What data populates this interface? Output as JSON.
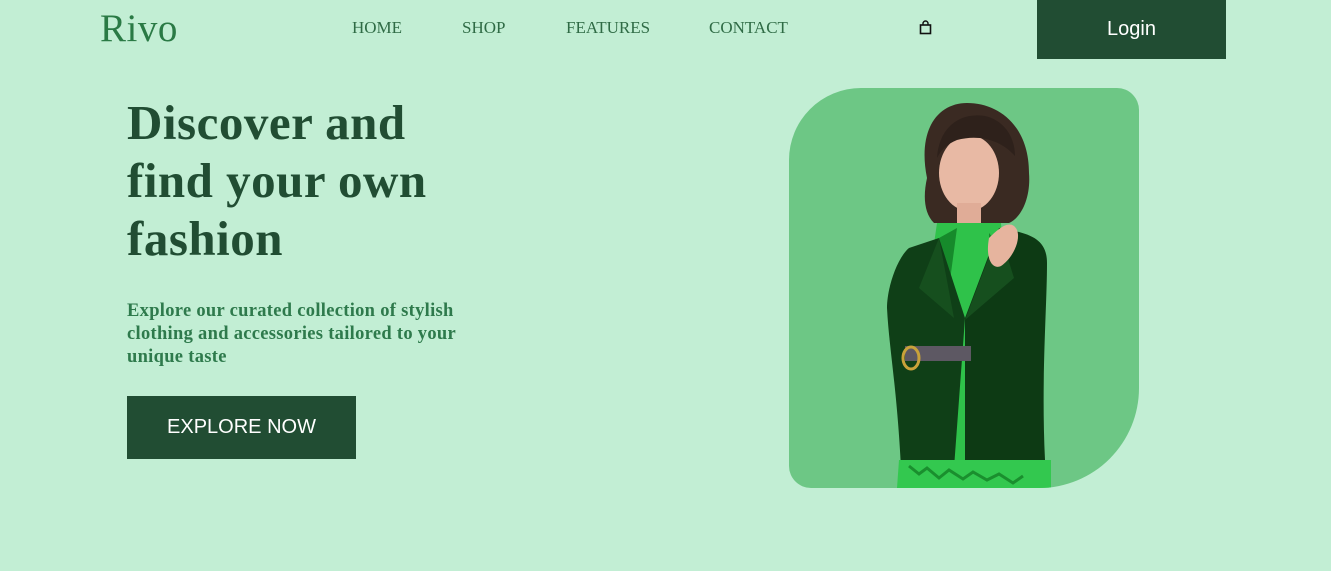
{
  "brand": {
    "logo": "Rivo"
  },
  "nav": {
    "items": [
      "HOME",
      "SHOP",
      "FEATURES",
      "CONTACT"
    ]
  },
  "header": {
    "cart_icon": "shopping-bag-icon",
    "login_label": "Login"
  },
  "hero": {
    "title_lines": [
      "Discover and",
      "find your own",
      "fashion"
    ],
    "subtitle": "Explore our curated collection of stylish clothing and accessories tailored to your unique taste",
    "cta_label": "EXPLORE NOW"
  },
  "colors": {
    "background": "#c2eed4",
    "primary_dark": "#214d33",
    "accent_green": "#2e7a4c",
    "image_panel": "#6dc785"
  }
}
